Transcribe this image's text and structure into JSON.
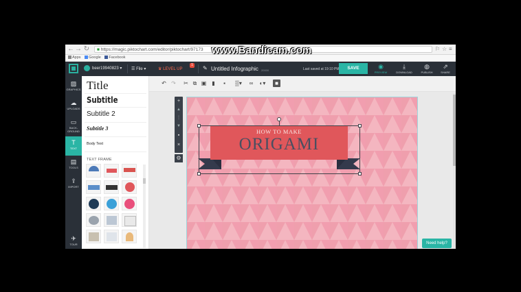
{
  "browser": {
    "url": "https://magic.piktochart.com/editor/piktochart/97173",
    "bookmarks": [
      "Apps",
      "Google",
      "Facebook"
    ]
  },
  "watermark": "www.Bandicam.com",
  "header": {
    "username": "beer19940823",
    "file_label": "File",
    "levelup_label": "LEVEL UP",
    "notification_count": "1",
    "doc_title": "Untitled Infographic",
    "zoom": "20000",
    "saved_status": "Last saved at 19:10 PM",
    "save_label": "SAVE",
    "tools": [
      {
        "label": "PREVIEW",
        "icon": "eye-icon"
      },
      {
        "label": "DOWNLOAD",
        "icon": "download-icon"
      },
      {
        "label": "PUBLISH",
        "icon": "globe-icon"
      },
      {
        "label": "SHARE",
        "icon": "share-icon"
      }
    ]
  },
  "sidebar": {
    "items": [
      {
        "label": "GRAPHICS",
        "icon": "image-icon"
      },
      {
        "label": "UPLOADS",
        "icon": "cloud-upload-icon"
      },
      {
        "label": "BACK-GROUND",
        "icon": "background-icon"
      },
      {
        "label": "TEXT",
        "icon": "text-icon",
        "active": true
      },
      {
        "label": "TOOLS",
        "icon": "tools-icon"
      },
      {
        "label": "IMPORT",
        "icon": "import-icon"
      },
      {
        "label": "TOUR",
        "icon": "tour-icon"
      }
    ]
  },
  "text_panel": {
    "title": "Title",
    "subtitle1": "Subtitle",
    "subtitle2": "Subtitle 2",
    "subtitle3": "Subtitle 3",
    "body": "Body Text",
    "frame_heading": "TEXT FRAME"
  },
  "canvas": {
    "banner_line1": "HOW TO MAKE",
    "banner_line2": "ORIGAMI",
    "colors": {
      "background_pink": "#f2a9b5",
      "banner_red": "#e0575b",
      "banner_text_dark": "#4a4f61",
      "accent_teal": "#2ab5a5"
    }
  },
  "help_label": "Need help?"
}
